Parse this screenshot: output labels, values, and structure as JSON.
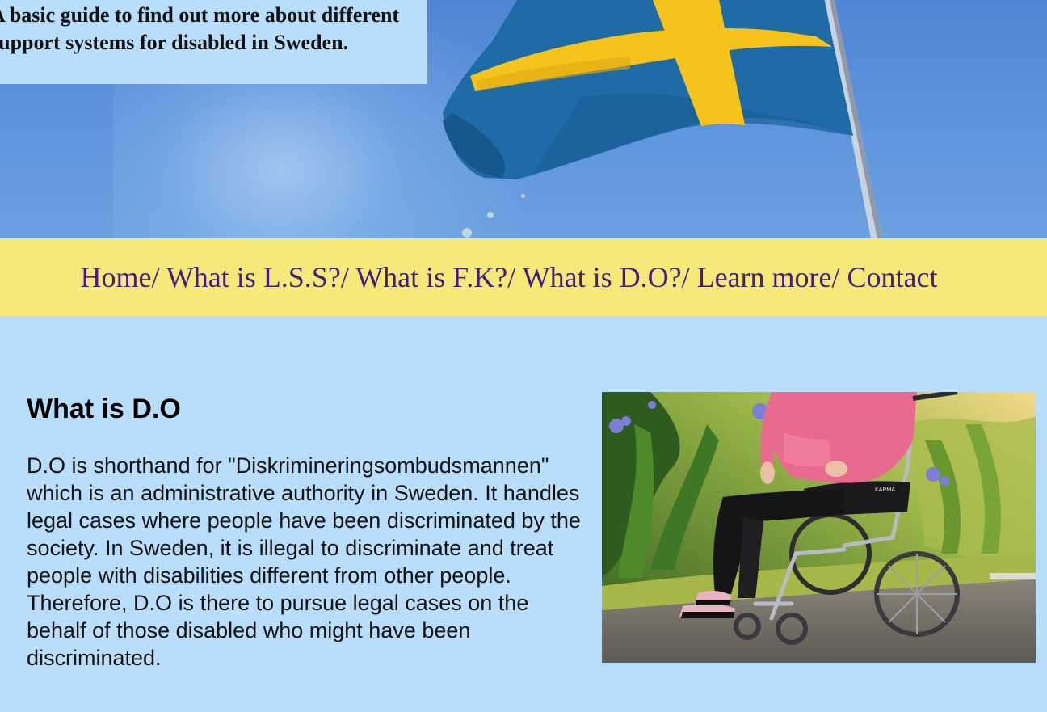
{
  "hero": {
    "intro_text": "A basic guide to find out more about different support systems for disabled in Sweden."
  },
  "nav": {
    "items": [
      "Home",
      "What is L.S.S?",
      "What is F.K?",
      "What is D.O?",
      "Learn more",
      "Contact"
    ],
    "separator": "/ "
  },
  "main": {
    "heading": "What is D.O",
    "paragraph": "D.O is shorthand for \"Diskrimineringsombudsmannen\" which is an administrative authority in Sweden. It handles legal cases where people have been discriminated by the society. In Sweden, it is illegal to discriminate and treat people with disabilities different from other people. Therefore, D.O is there to pursue legal cases on the behalf of those disabled who might have been discriminated.",
    "photo_brand": "KARMA"
  },
  "colors": {
    "page_bg": "#b8defc",
    "nav_bg": "#f5e97a",
    "nav_text": "#4b1a7e",
    "flag_blue": "#1f6ba6",
    "flag_yellow": "#f6c21c"
  }
}
